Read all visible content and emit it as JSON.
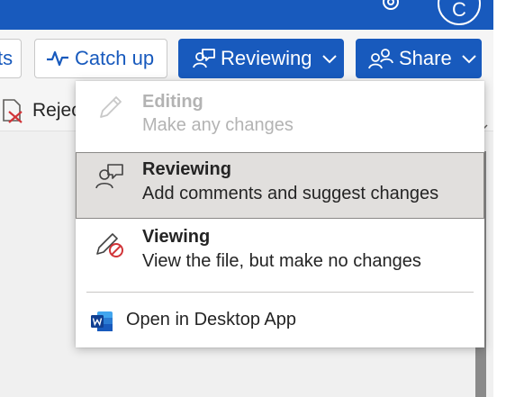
{
  "titlebar": {
    "avatar_initial": "C",
    "icons": [
      "gear-icon"
    ]
  },
  "toolbar": {
    "partial_left_label": "ts",
    "catch_up_label": "Catch up",
    "reviewing_label": "Reviewing",
    "share_label": "Share",
    "reject_label": "Rejec",
    "icons": [
      "pulse-icon",
      "reviewing-icon",
      "chevron-down-icon",
      "share-people-icon",
      "reject-icon"
    ]
  },
  "mode_menu": {
    "items": [
      {
        "title": "Editing",
        "description": "Make any changes",
        "state": "disabled",
        "icon": "pencil-icon"
      },
      {
        "title": "Reviewing",
        "description": "Add comments and suggest changes",
        "state": "selected",
        "icon": "reviewing-icon"
      },
      {
        "title": "Viewing",
        "description": "View the file, but make no changes",
        "state": "normal",
        "icon": "pencil-prohibited-icon"
      }
    ],
    "open_desktop_label": "Open in Desktop App",
    "open_desktop_icon": "word-icon"
  },
  "colors": {
    "brand_blue": "#185abd",
    "selected_bg": "#e1dfdd",
    "prohibit_red": "#d13438"
  }
}
